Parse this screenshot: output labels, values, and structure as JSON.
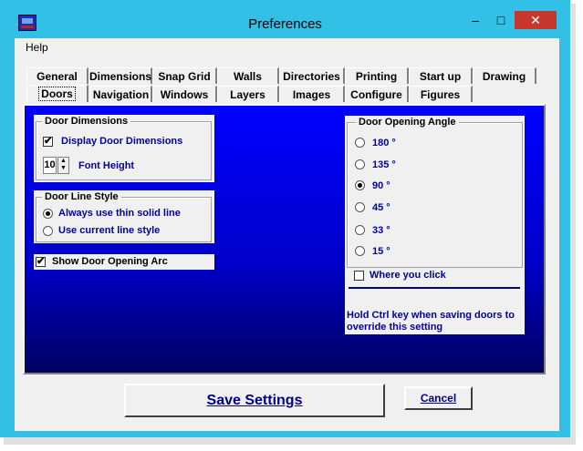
{
  "window": {
    "title": "Preferences",
    "minimize": "–",
    "maximize": "□",
    "close": "✕"
  },
  "menu": {
    "help": "Help"
  },
  "tabs_back": [
    "General",
    "Dimensions",
    "Snap Grid",
    "Walls",
    "Directories",
    "Printing",
    "Start up",
    "Drawing"
  ],
  "tabs_front": [
    "Doors",
    "Navigation",
    "Windows",
    "Layers",
    "Images",
    "Configure",
    "Figures"
  ],
  "tab_ghost": "Dimensions",
  "door_dimensions": {
    "legend": "Door Dimensions",
    "display_label": "Display Door Dimensions",
    "display_checked": "✔",
    "font_height_value": "10",
    "font_height_label": "Font Height"
  },
  "door_line_style": {
    "legend": "Door Line Style",
    "opt1": "Always use thin solid line",
    "opt2": "Use current line style"
  },
  "show_arc": {
    "label": "Show Door Opening Arc",
    "checked": "✔"
  },
  "door_angle": {
    "legend": "Door Opening Angle",
    "options": [
      "180 °",
      "135 °",
      "90 °",
      "45 °",
      "33 °",
      "15 °"
    ],
    "where_label": "Where you click",
    "hint": "Hold Ctrl key when saving doors to override this setting"
  },
  "buttons": {
    "save": "Save Settings",
    "cancel": "Cancel"
  },
  "colors": {
    "accent_frame": "#33c0e6",
    "panel_blue": "#0000ff",
    "button_text": "#00008b"
  }
}
